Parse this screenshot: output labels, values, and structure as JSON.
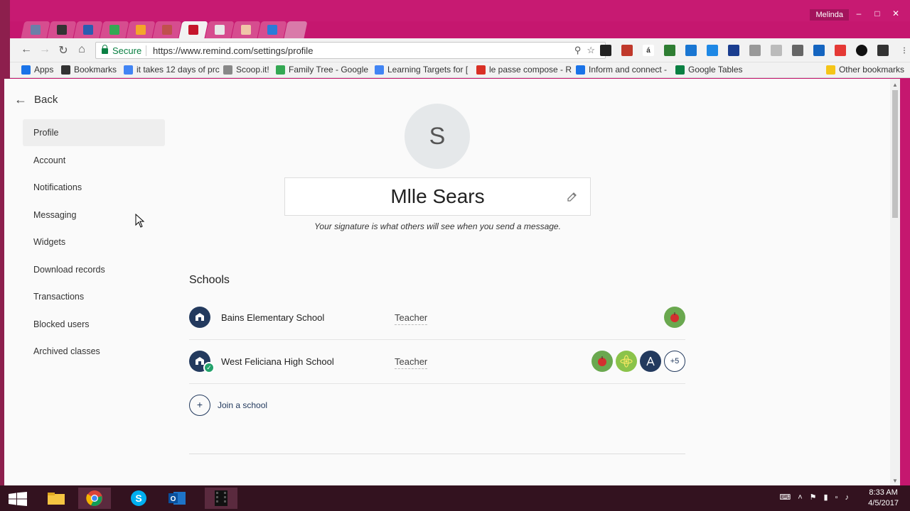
{
  "window": {
    "user": "Melinda",
    "minimize": "–",
    "maximize": "□",
    "close": "✕"
  },
  "toolbar": {
    "secure_label": "Secure",
    "url": "https://www.remind.com/settings/profile"
  },
  "bookmarks": [
    {
      "label": "Apps",
      "icon": "apps-grid-icon",
      "color": "#1a73e8"
    },
    {
      "label": "Bookmarks",
      "icon": "star-icon",
      "color": "#333333"
    },
    {
      "label": "it takes 12 days of prc",
      "icon": "google-icon",
      "color": "#4285f4"
    },
    {
      "label": "Scoop.it!",
      "icon": "page-icon",
      "color": "#888888"
    },
    {
      "label": "Family Tree - Google",
      "icon": "drive-icon",
      "color": "#34a853"
    },
    {
      "label": "Learning Targets for [",
      "icon": "docs-icon",
      "color": "#4285f4"
    },
    {
      "label": "le passe compose - R",
      "icon": "pin-icon",
      "color": "#d93025"
    },
    {
      "label": "Inform and connect -",
      "icon": "globe-icon",
      "color": "#1a73e8"
    },
    {
      "label": "Google Tables",
      "icon": "tables-icon",
      "color": "#0b8043"
    }
  ],
  "bookmarks_other": "Other bookmarks",
  "bookmarks_overflow": "»",
  "page": {
    "back_label": "Back",
    "nav": [
      "Profile",
      "Account",
      "Notifications",
      "Messaging",
      "Widgets",
      "Download records",
      "Transactions",
      "Blocked users",
      "Archived classes"
    ],
    "avatar_initial": "S",
    "display_name": "Mlle Sears",
    "signature_note": "Your signature is what others will see when you send a message.",
    "schools_title": "Schools",
    "schools": [
      {
        "name": "Bains Elementary School",
        "role": "Teacher",
        "verified": false
      },
      {
        "name": "West Feliciana High School",
        "role": "Teacher",
        "verified": true,
        "more": "+5"
      }
    ],
    "join_label": "Join a school"
  },
  "taskbar": {
    "time": "8:33 AM",
    "date": "4/5/2017"
  },
  "colors": {
    "accent": "#233a5e",
    "tab_bar": "#c71a72",
    "secure": "#0b8043"
  }
}
